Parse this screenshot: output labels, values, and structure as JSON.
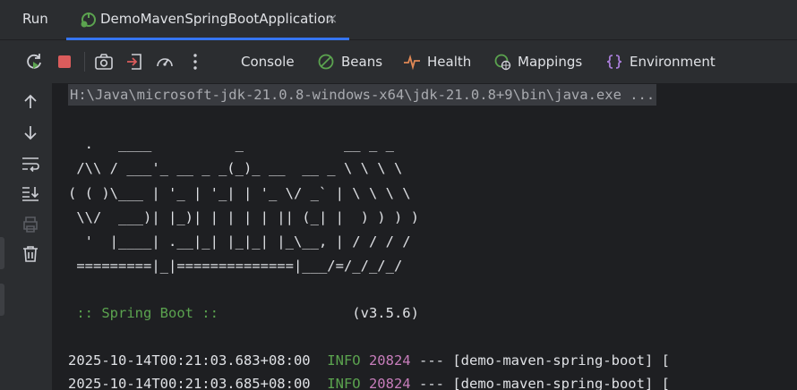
{
  "titlebar": {
    "run_label": "Run",
    "tab_label": "DemoMavenSpringBootApplication",
    "tab_close": "×"
  },
  "toolbar": {
    "tabs": [
      {
        "label": "Console",
        "icon": "console"
      },
      {
        "label": "Beans",
        "icon": "beans-icon"
      },
      {
        "label": "Health",
        "icon": "health-icon"
      },
      {
        "label": "Mappings",
        "icon": "mappings-icon"
      },
      {
        "label": "Environment",
        "icon": "environment-icon"
      }
    ],
    "icons": [
      "rerun-icon",
      "stop-icon",
      "screenshot-icon",
      "exit-icon",
      "dashboard-icon",
      "more-icon"
    ]
  },
  "gutter": {
    "icons": [
      "arrow-up-icon",
      "arrow-down-icon",
      "soft-wrap-icon",
      "scroll-to-end-icon",
      "print-icon",
      "trash-icon"
    ]
  },
  "console": {
    "command": "H:\\Java\\microsoft-jdk-21.0.8-windows-x64\\jdk-21.0.8+9\\bin\\java.exe ...",
    "banner": "  .   ____          _            __ _ _\n /\\\\ / ___'_ __ _ _(_)_ __  __ _ \\ \\ \\ \\\n( ( )\\___ | '_ | '_| | '_ \\/ _` | \\ \\ \\ \\\n \\\\/  ___)| |_)| | | | | || (_| |  ) ) ) )\n  '  |____| .__|_| |_|_| |_\\__, | / / / /\n =========|_|==============|___/=/_/_/_/",
    "spring_label": " :: Spring Boot :: ",
    "spring_version": "(v3.5.6)",
    "logs": [
      {
        "timestamp": "2025-10-14T00:21:03.683+08:00",
        "level": "INFO",
        "pid": "20824",
        "sep": "---",
        "app": "[demo-maven-spring-boot] ["
      },
      {
        "timestamp": "2025-10-14T00:21:03.685+08:00",
        "level": "INFO",
        "pid": "20824",
        "sep": "---",
        "app": "[demo-maven-spring-boot] ["
      }
    ]
  },
  "colors": {
    "accent": "#3574f0",
    "info_green": "#5ba34f",
    "pid_purple": "#c77dbb",
    "stop_red": "#db5c5c"
  }
}
